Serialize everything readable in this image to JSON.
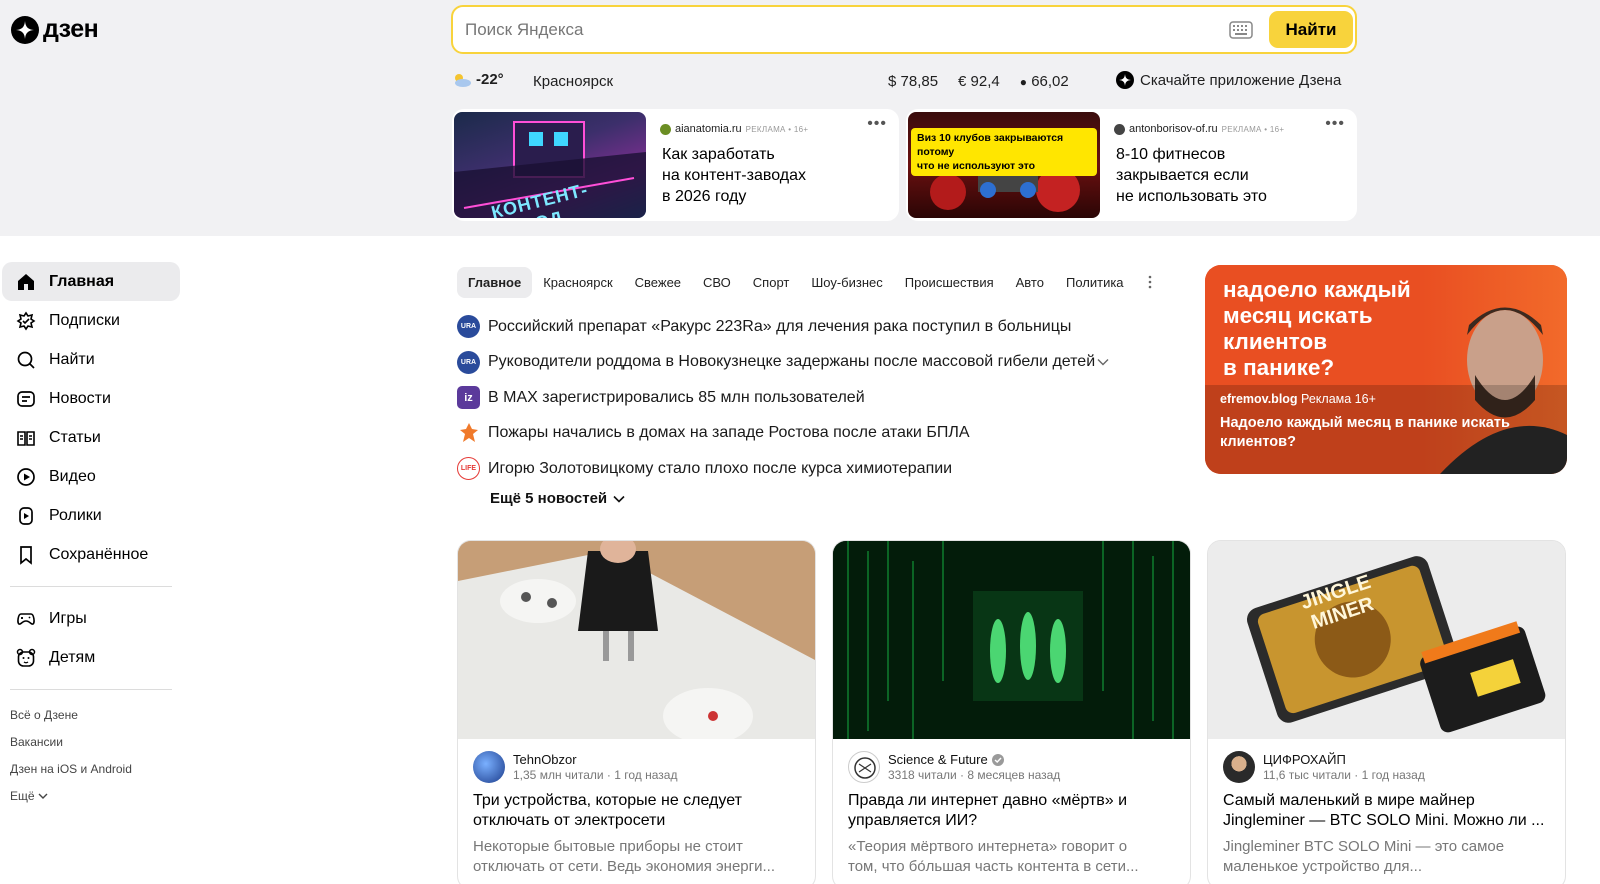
{
  "logo": {
    "text": "дзен"
  },
  "search": {
    "placeholder": "Поиск Яндекса",
    "button": "Найти"
  },
  "info": {
    "temperature": "-22°",
    "city": "Красноярск",
    "rates": [
      "$ 78,85",
      "€ 92,4",
      "66,02"
    ],
    "download": "Скачайте приложение Дзена"
  },
  "ads": [
    {
      "source": "aianatomia.ru",
      "meta": "РЕКЛАМА • 16+",
      "title_lines": [
        "Как заработать",
        "на контент-заводах",
        "в 2026 году"
      ],
      "image_caption": "КОНТЕНТ-ЗАВОД",
      "more": "•••"
    },
    {
      "source": "antonborisov-of.ru",
      "meta": "РЕКЛАМА • 16+",
      "title_lines": [
        "8-10 фитнесов",
        "закрывается если",
        "не использовать это"
      ],
      "image_caption_lines": [
        "Виз 10 клубов закрываются потому",
        "что не используют это"
      ],
      "more": "•••"
    }
  ],
  "sidebar": {
    "items": [
      {
        "label": "Главная",
        "icon": "home-icon",
        "active": true
      },
      {
        "label": "Подписки",
        "icon": "subscriptions-icon"
      },
      {
        "label": "Найти",
        "icon": "search-icon"
      },
      {
        "label": "Новости",
        "icon": "news-icon"
      },
      {
        "label": "Статьи",
        "icon": "articles-icon"
      },
      {
        "label": "Видео",
        "icon": "video-icon"
      },
      {
        "label": "Ролики",
        "icon": "shorts-icon"
      },
      {
        "label": "Сохранённое",
        "icon": "bookmark-icon"
      }
    ],
    "secondary": [
      {
        "label": "Игры",
        "icon": "gamepad-icon"
      },
      {
        "label": "Детям",
        "icon": "kids-icon"
      }
    ],
    "footer": [
      "Всё о Дзене",
      "Вакансии",
      "Дзен на iOS и Android",
      "Ещё"
    ]
  },
  "tabs": [
    "Главное",
    "Красноярск",
    "Свежее",
    "СВО",
    "Спорт",
    "Шоу-бизнес",
    "Происшествия",
    "Авто",
    "Политика"
  ],
  "news": [
    {
      "text": "Российский препарат «Ракурс 223Ra» для лечения рака поступил в больницы",
      "source_icon": "URA.RU",
      "color": "#2a4b9b"
    },
    {
      "text": "Руководители роддома в Новокузнецке задержаны после массовой гибели детей",
      "source_icon": "URA.RU",
      "color": "#2a4b9b"
    },
    {
      "text": "В MAX зарегистрировались 85 млн пользователей",
      "source_icon": "iz",
      "color": "#5b3a9b"
    },
    {
      "text": "Пожары начались в домах на западе Ростова после атаки БПЛА",
      "source_icon": "flame",
      "color": "#f07a2b"
    },
    {
      "text": "Игорю Золотовицкому стало плохо после курса химиотерапии",
      "source_icon": "LIFE",
      "color": "#e53935"
    }
  ],
  "more_news": "Ещё 5 новостей",
  "promo": {
    "headline_lines": [
      "надоело каждый",
      "месяц искать",
      "клиентов",
      "в панике?"
    ],
    "source": "efremov.blog",
    "meta": "Реклама 16+",
    "title": "Надоело каждый месяц в панике искать клиентов?"
  },
  "cards": [
    {
      "author": "TehnObzor",
      "meta": "1,35 млн читали · 1 год назад",
      "title_lines": [
        "Три устройства, которые не следует",
        "отключать от электросети"
      ],
      "desc_lines": [
        "Некоторые бытовые приборы не стоит",
        "отключать от сети. Ведь экономия энерги..."
      ],
      "verified": false
    },
    {
      "author": "Science & Future",
      "meta": "3318 читали · 8 месяцев назад",
      "title_lines": [
        "Правда ли интернет давно «мёртв» и",
        "управляется ИИ?"
      ],
      "desc_lines": [
        "«Теория мёртвого интернета» говорит о",
        "том, что бо́льшая часть контента в сети..."
      ],
      "verified": true
    },
    {
      "author": "ЦИФРОХАЙП",
      "meta": "11,6 тыс читали · 1 год назад",
      "title_lines": [
        "Самый маленький в мире майнер",
        "Jingleminer — BTC SOLO Mini. Можно ли ..."
      ],
      "desc_lines": [
        "Jingleminer BTC SOLO Mini — это самое",
        "маленькое устройство для..."
      ],
      "image_caption_lines": [
        "JINGLE",
        "MINER"
      ],
      "verified": false
    }
  ],
  "colors": {
    "accent": "#f8d33c",
    "promo": "#e94f22"
  }
}
